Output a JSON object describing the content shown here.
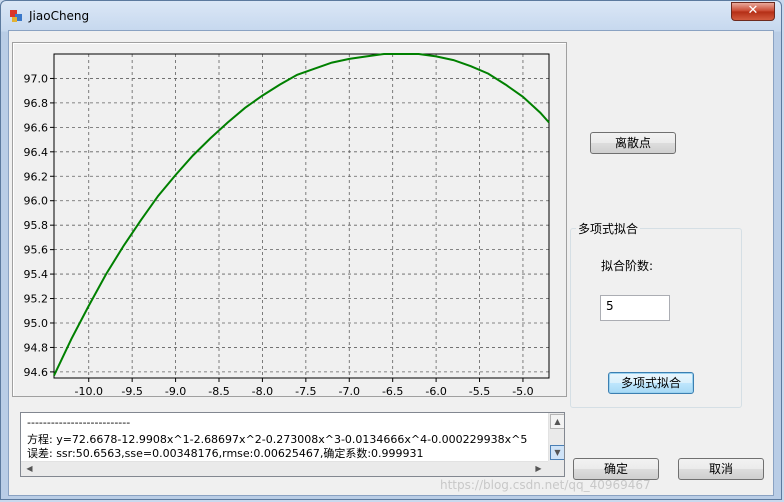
{
  "window": {
    "title": "JiaoCheng",
    "close_glyph": "✕"
  },
  "buttons": {
    "scatter": "离散点",
    "poly_fit": "多项式拟合",
    "ok": "确定",
    "cancel": "取消"
  },
  "group": {
    "title": "多项式拟合",
    "order_label": "拟合阶数:",
    "order_value": "5"
  },
  "output": {
    "lines": [
      "--------------------------",
      "方程: y=72.6678-12.9908x^1-2.68697x^2-0.273008x^3-0.0134666x^4-0.000229938x^5",
      "误差: ssr:50.6563,sse=0.00348176,rmse:0.00625467,确定系数:0.999931"
    ]
  },
  "watermark": "https://blog.csdn.net/qq_40969467",
  "colors": {
    "line": "#008000",
    "plot_bg": "#f0f0f0",
    "grid": "#606060"
  },
  "chart_data": {
    "type": "line",
    "xlim": [
      -10.4,
      -4.7
    ],
    "ylim": [
      94.55,
      97.2
    ],
    "grid": true,
    "x_ticks": [
      -10.0,
      -9.5,
      -9.0,
      -8.5,
      -8.0,
      -7.5,
      -7.0,
      -6.5,
      -6.0,
      -5.5,
      -5.0
    ],
    "x_tick_labels": [
      "-10.0",
      "-9.5",
      "-9.0",
      "-8.5",
      "-8.0",
      "-7.5",
      "-7.0",
      "-6.5",
      "-6.0",
      "-5.5",
      "-5.0"
    ],
    "y_ticks": [
      94.6,
      94.8,
      95.0,
      95.2,
      95.4,
      95.6,
      95.8,
      96.0,
      96.2,
      96.4,
      96.6,
      96.8,
      97.0
    ],
    "y_tick_labels": [
      "94.6",
      "94.8",
      "95.0",
      "95.2",
      "95.4",
      "95.6",
      "95.8",
      "96.0",
      "96.2",
      "96.4",
      "96.6",
      "96.8",
      "97.0"
    ],
    "series": [
      {
        "x": [
          -10.4,
          -10.2,
          -10.0,
          -9.8,
          -9.6,
          -9.4,
          -9.2,
          -9.0,
          -8.8,
          -8.6,
          -8.4,
          -8.2,
          -8.0,
          -7.8,
          -7.6,
          -7.4,
          -7.2,
          -7.0,
          -6.8,
          -6.6,
          -6.4,
          -6.2,
          -6.0,
          -5.8,
          -5.6,
          -5.4,
          -5.2,
          -5.0,
          -4.8,
          -4.7
        ],
        "y": [
          94.57,
          94.87,
          95.14,
          95.4,
          95.63,
          95.84,
          96.04,
          96.21,
          96.37,
          96.51,
          96.64,
          96.76,
          96.86,
          96.95,
          97.03,
          97.08,
          97.13,
          97.16,
          97.18,
          97.2,
          97.2,
          97.2,
          97.18,
          97.15,
          97.1,
          97.04,
          96.95,
          96.85,
          96.72,
          96.64
        ]
      }
    ]
  }
}
